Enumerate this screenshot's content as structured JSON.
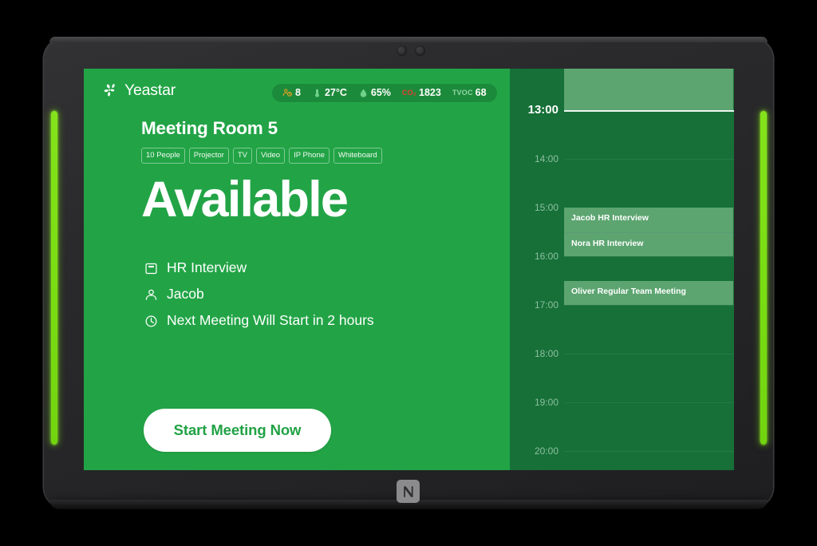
{
  "device": {
    "led_color": "#7ADE12",
    "bezel_color": "#2A2A2C",
    "nfc_label": "nfc-logo"
  },
  "screen": {
    "accent_green": "#22A446",
    "timeline_green": "#167038",
    "event_green": "#5CA570"
  },
  "header": {
    "brand_name": "Yeastar",
    "brand_mark_icon": "yeastar-flower-icon",
    "sensors": [
      {
        "icon": "occupancy-people-icon",
        "icon_color": "#E8A020",
        "value": "8",
        "label": ""
      },
      {
        "icon": "thermometer-icon",
        "icon_color": "#6FD18A",
        "value": "27°C",
        "label": ""
      },
      {
        "icon": "humidity-drop-icon",
        "icon_color": "#6FD18A",
        "value": "65%",
        "label": ""
      },
      {
        "icon": "co2-text-icon",
        "icon_color": "#F03A32",
        "value": "1823",
        "label": "CO₂"
      },
      {
        "icon": "tvoc-text-icon",
        "icon_color": "#8FD7A5",
        "value": "68",
        "label": "TVOC"
      }
    ]
  },
  "room": {
    "title": "Meeting Room 5",
    "amenities": [
      "10 People",
      "Projector",
      "TV",
      "Video",
      "IP Phone",
      "Whiteboard"
    ],
    "status": "Available"
  },
  "details": [
    {
      "icon": "calendar-event-icon",
      "text": "HR Interview"
    },
    {
      "icon": "person-icon",
      "text": "Jacob"
    },
    {
      "icon": "clock-icon",
      "text": "Next Meeting Will  Start in 2 hours"
    }
  ],
  "actions": {
    "start_meeting_label": "Start Meeting Now"
  },
  "timeline": {
    "hours": [
      {
        "label": "13:00",
        "current": true
      },
      {
        "label": "14:00",
        "current": false
      },
      {
        "label": "15:00",
        "current": false
      },
      {
        "label": "16:00",
        "current": false
      },
      {
        "label": "17:00",
        "current": false
      },
      {
        "label": "18:00",
        "current": false
      },
      {
        "label": "19:00",
        "current": false
      },
      {
        "label": "20:00",
        "current": false
      }
    ],
    "events": [
      {
        "organizer": "",
        "title": "",
        "text": "",
        "start": "before-13:00",
        "end": "13:00"
      },
      {
        "organizer": "Jacob",
        "title": "HR Interview",
        "text": "Jacob  HR Interview",
        "start": "15:00",
        "end": "15:30"
      },
      {
        "organizer": "Nora",
        "title": "HR Interview",
        "text": "Nora  HR Interview",
        "start": "15:30",
        "end": "16:00"
      },
      {
        "organizer": "Oliver",
        "title": "Regular Team Meeting",
        "text": "Oliver  Regular Team Meeting",
        "start": "16:30",
        "end": "17:00"
      }
    ]
  }
}
